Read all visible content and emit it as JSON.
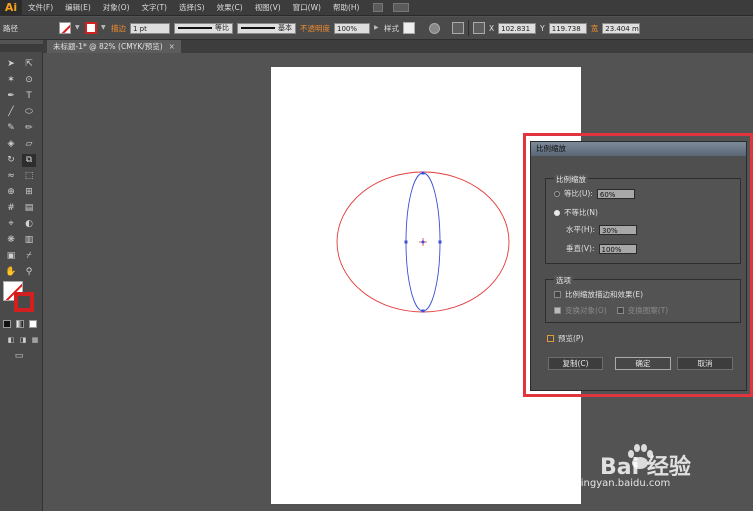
{
  "app": {
    "logo": "Ai"
  },
  "menu": [
    "文件(F)",
    "编辑(E)",
    "对象(O)",
    "文字(T)",
    "选择(S)",
    "效果(C)",
    "视图(V)",
    "窗口(W)",
    "帮助(H)"
  ],
  "controlbar": {
    "path_label": "路径",
    "stroke_label": "描边",
    "stroke_weight": "1 pt",
    "stroke_profile": "等比",
    "brush": "基本",
    "opacity_label": "不透明度",
    "opacity_value": "100%",
    "style_label": "样式",
    "x_label": "X",
    "x_value": "102.831",
    "y_label": "Y",
    "y_value": "119.738",
    "w_label": "宽",
    "w_value": "23.404 m"
  },
  "document": {
    "tab_title": "未标题-1* @ 82% (CMYK/预览)",
    "close": "×"
  },
  "dialog": {
    "title": "比例缩放",
    "group_scale": "比例缩放",
    "uniform_label": "等比(U):",
    "uniform_value": "60%",
    "nonuniform_label": "不等比(N)",
    "horizontal_label": "水平(H):",
    "horizontal_value": "30%",
    "vertical_label": "垂直(V):",
    "vertical_value": "100%",
    "group_options": "选项",
    "scale_strokes_label": "比例缩放描边和效果(E)",
    "transform_objects_label": "变换对象(O)",
    "transform_patterns_label": "变换图案(T)",
    "preview_label": "预览(P)",
    "copy_button": "复制(C)",
    "ok_button": "确定",
    "cancel_button": "取消"
  },
  "watermark": {
    "main": "Bai 经验",
    "sub": "jingyan.baidu.com"
  },
  "colors": {
    "accent_red": "#e0353d",
    "ellipse_red": "#e23a3a",
    "ellipse_blue": "#3b4fd6",
    "app_orange": "#f7a21c"
  }
}
